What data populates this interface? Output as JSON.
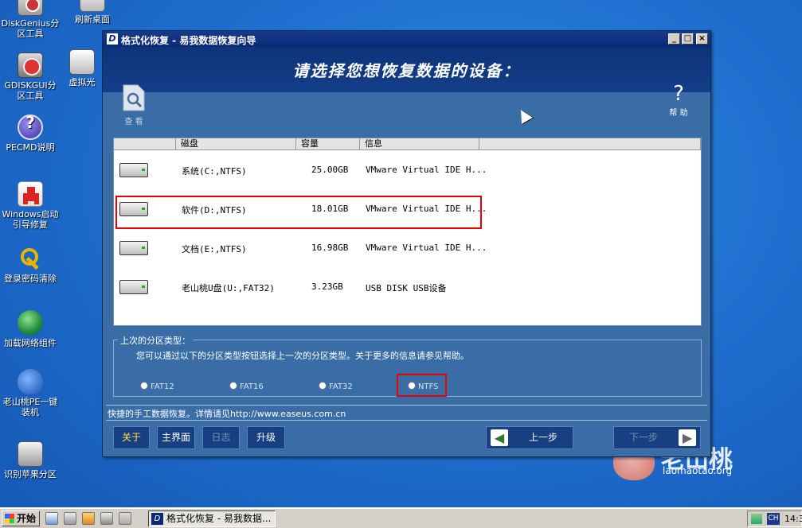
{
  "desktop": {
    "icons": [
      {
        "label": "DiskGenius分区工具",
        "icon": "diskgenius-icon"
      },
      {
        "label": "刷新桌面",
        "icon": "refresh-desktop-icon"
      },
      {
        "label": "GDISKGUI分区工具",
        "icon": "gdiskgui-icon"
      },
      {
        "label": "虚拟光",
        "icon": "virtual-drive-icon"
      },
      {
        "label": "PECMD说明",
        "icon": "help-icon"
      },
      {
        "label": "Windows启动引导修复",
        "icon": "boot-repair-icon"
      },
      {
        "label": "登录密码清除",
        "icon": "key-icon"
      },
      {
        "label": "加载网络组件",
        "icon": "network-globe-icon"
      },
      {
        "label": "老山桃PE一键装机",
        "icon": "peach-icon"
      },
      {
        "label": "识别苹果分区",
        "icon": "apple-partition-icon"
      }
    ],
    "logo": {
      "main": "老山桃",
      "url": "laomaotao.org"
    }
  },
  "window": {
    "title": "格式化恢复 - 易我数据恢复向导",
    "app_icon": "D",
    "controls": {
      "minimize": "_",
      "maximize": "□",
      "close": "×"
    },
    "header": "请选择您想恢复数据的设备：",
    "tools": {
      "view": "查 看",
      "help_glyph": "?",
      "help": "帮 助"
    },
    "table": {
      "columns": [
        "磁盘",
        "容量",
        "信息"
      ],
      "rows": [
        {
          "disk": "系统(C:,NTFS)",
          "size": "25.00GB",
          "info": "VMware Virtual IDE H..."
        },
        {
          "disk": "软件(D:,NTFS)",
          "size": "18.01GB",
          "info": "VMware Virtual IDE H..."
        },
        {
          "disk": "文档(E:,NTFS)",
          "size": "16.98GB",
          "info": "VMware Virtual IDE H..."
        },
        {
          "disk": "老山桃U盘(U:,FAT32)",
          "size": "3.23GB",
          "info": "USB DISK USB设备"
        }
      ]
    },
    "partition_group": {
      "legend": "上次的分区类型：",
      "description": "您可以通过以下的分区类型按钮选择上一次的分区类型。关于更多的信息请参见帮助。",
      "options": [
        "FAT12",
        "FAT16",
        "FAT32",
        "NTFS"
      ]
    },
    "status": "快捷的手工数据恢复。详情请见http://www.easeus.com.cn",
    "buttons": {
      "about": "关于",
      "home": "主界面",
      "log": "日志",
      "upgrade": "升级",
      "prev": "上一步",
      "next": "下一步"
    }
  },
  "taskbar": {
    "start": "开始",
    "task_label": "格式化恢复 - 易我数据...",
    "tray": {
      "lang": "CH",
      "clock": "14:3"
    }
  }
}
